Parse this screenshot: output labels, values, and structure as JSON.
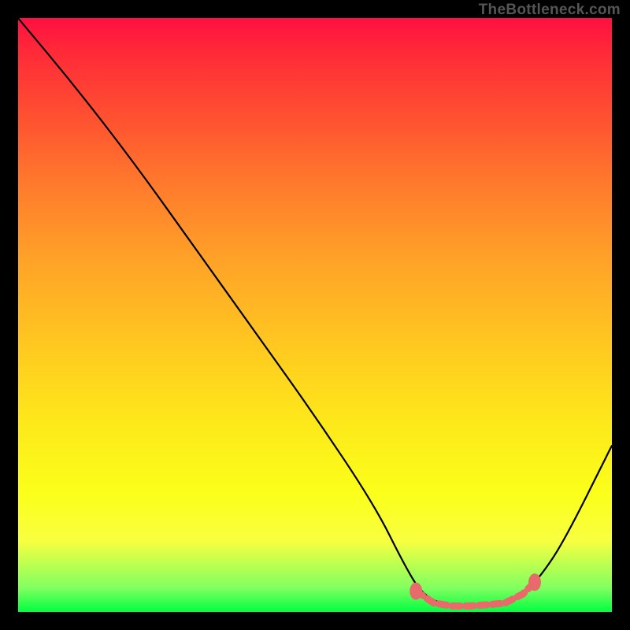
{
  "watermark": "TheBottleneck.com",
  "chart_data": {
    "type": "line",
    "title": "",
    "xlabel": "",
    "ylabel": "",
    "xlim": [
      0,
      100
    ],
    "ylim": [
      0,
      100
    ],
    "series": [
      {
        "name": "bottleneck-curve",
        "x": [
          0,
          10,
          20,
          30,
          40,
          50,
          60,
          65,
          68,
          72,
          78,
          82,
          85,
          88,
          92,
          100
        ],
        "y": [
          100,
          88,
          75,
          61,
          47,
          33,
          18,
          8,
          3,
          1,
          1,
          1,
          3,
          6,
          12,
          28
        ]
      }
    ],
    "markers": {
      "name": "highlighted-range",
      "color": "#E86A6A",
      "points": [
        {
          "x": 67,
          "y": 3.5
        },
        {
          "x": 70,
          "y": 1.5
        },
        {
          "x": 73,
          "y": 1
        },
        {
          "x": 76,
          "y": 1
        },
        {
          "x": 79,
          "y": 1.2
        },
        {
          "x": 82,
          "y": 1.5
        },
        {
          "x": 85,
          "y": 3
        },
        {
          "x": 87,
          "y": 5
        }
      ]
    }
  }
}
